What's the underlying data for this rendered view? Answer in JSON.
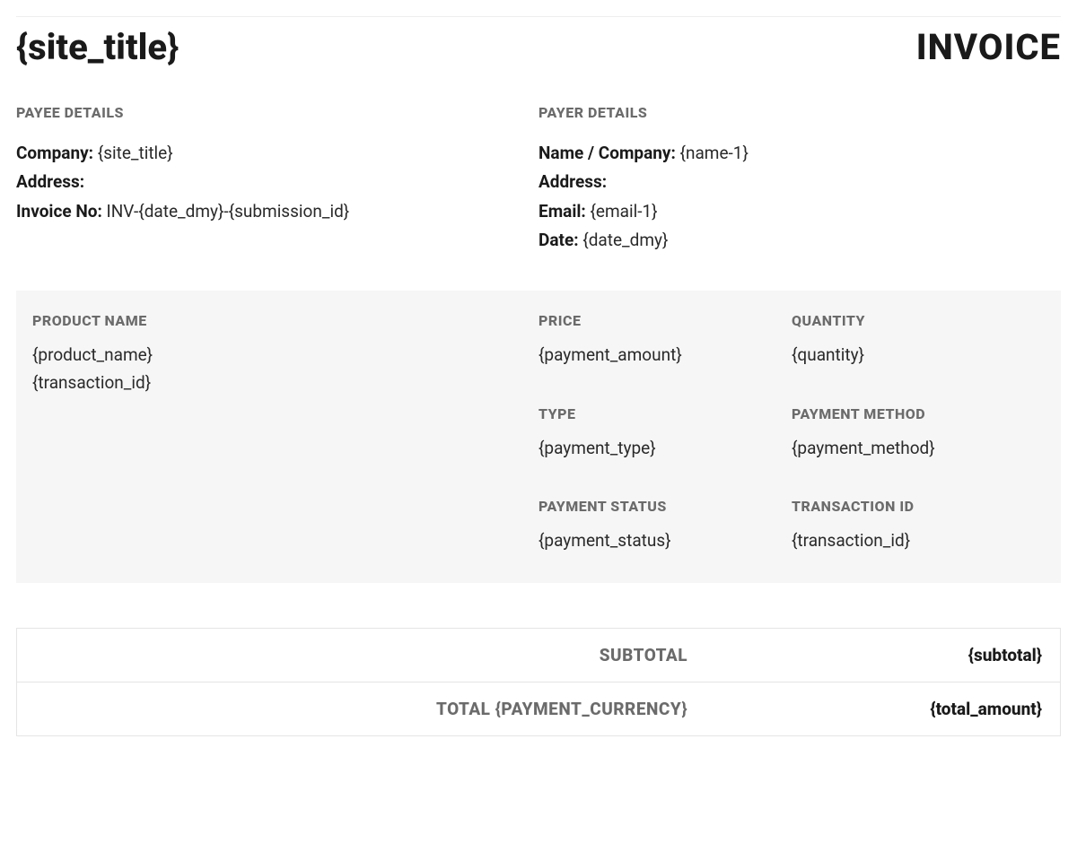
{
  "header": {
    "site_title": "{site_title}",
    "invoice_label": "INVOICE"
  },
  "payee": {
    "heading": "PAYEE DETAILS",
    "company_label": "Company:",
    "company_value": "{site_title}",
    "address_label": "Address:",
    "address_value": "",
    "invoice_no_label": "Invoice No:",
    "invoice_no_value": "INV-{date_dmy}-{submission_id}"
  },
  "payer": {
    "heading": "PAYER DETAILS",
    "name_label": "Name / Company:",
    "name_value": "{name-1}",
    "address_label": "Address:",
    "address_value": "",
    "email_label": "Email:",
    "email_value": "{email-1}",
    "date_label": "Date:",
    "date_value": "{date_dmy}"
  },
  "products": {
    "col1_heading": "PRODUCT NAME",
    "col2_heading": "PRICE",
    "col3_heading": "QUANTITY",
    "product_name": "{product_name}",
    "transaction_id_line": "{transaction_id}",
    "price": "{payment_amount}",
    "quantity": "{quantity}",
    "type_heading": "TYPE",
    "type_value": "{payment_type}",
    "method_heading": "PAYMENT METHOD",
    "method_value": "{payment_method}",
    "status_heading": "PAYMENT STATUS",
    "status_value": "{payment_status}",
    "txid_heading": "TRANSACTION ID",
    "txid_value": "{transaction_id}"
  },
  "totals": {
    "subtotal_label": "SUBTOTAL",
    "subtotal_value": "{subtotal}",
    "total_label": "TOTAL {PAYMENT_CURRENCY}",
    "total_value": "{total_amount}"
  }
}
